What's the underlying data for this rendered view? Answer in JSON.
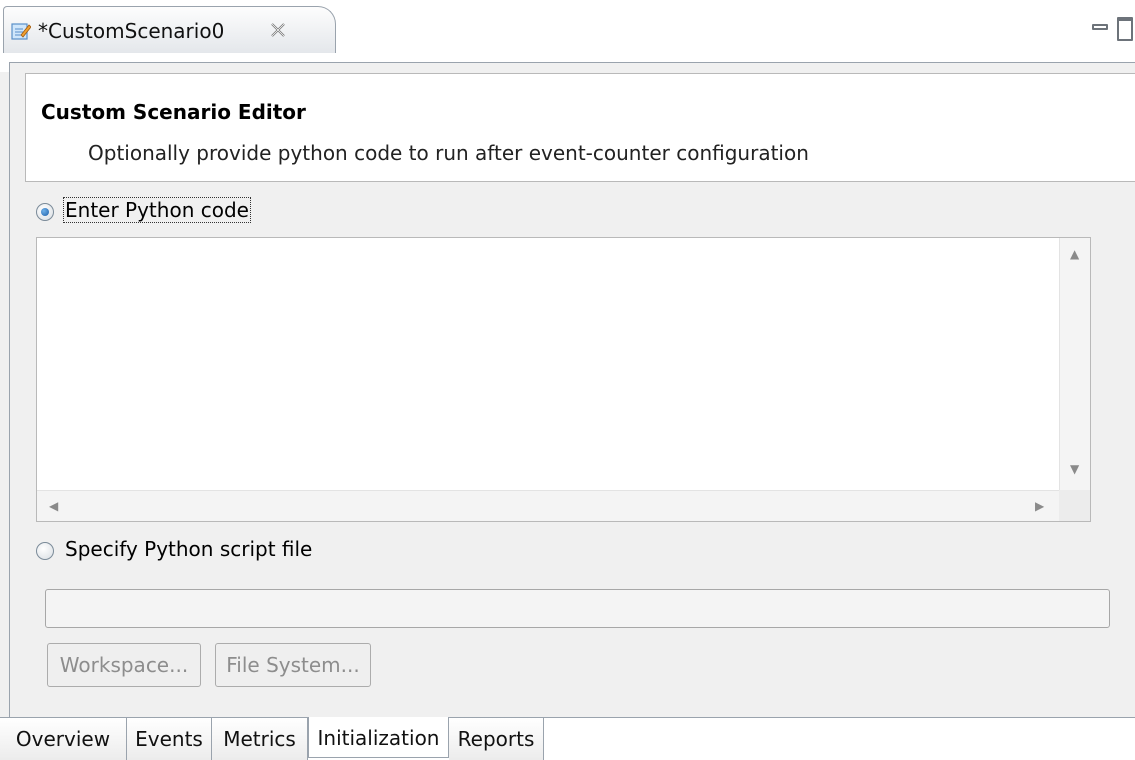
{
  "editor_tab": {
    "title": "*CustomScenario0",
    "icon": "edit-scenario-icon",
    "close_icon": "close-icon"
  },
  "window_controls": {
    "minimize_icon": "minimize-icon",
    "maximize_icon": "maximize-icon"
  },
  "header": {
    "title": "Custom Scenario Editor",
    "description": "Optionally provide python code to run after event-counter configuration"
  },
  "options": {
    "python_code": {
      "label": "Enter Python code",
      "selected": true
    },
    "script_file": {
      "label": "Specify Python script file",
      "selected": false
    }
  },
  "code_editor": {
    "value": ""
  },
  "script_path": {
    "value": ""
  },
  "buttons": {
    "workspace": "Workspace...",
    "file_system": "File System..."
  },
  "page_tabs": [
    {
      "label": "Overview"
    },
    {
      "label": "Events"
    },
    {
      "label": "Metrics"
    },
    {
      "label": "Initialization",
      "active": true
    },
    {
      "label": "Reports"
    }
  ]
}
